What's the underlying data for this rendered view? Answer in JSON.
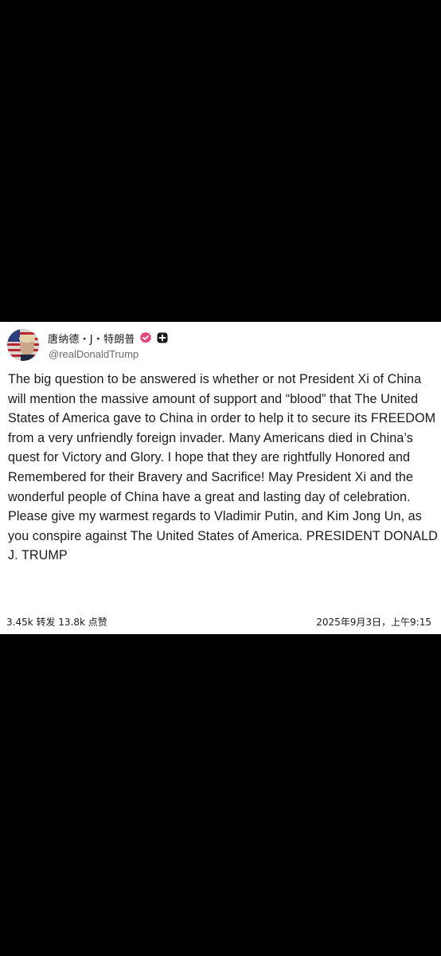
{
  "post": {
    "author": {
      "display_name": "唐纳德・J・特朗普",
      "handle": "@realDonaldTrump",
      "verified_icon": "verified-badge-icon",
      "extra_icon": "plus-badge-icon"
    },
    "body": "The big question to be  answered is whether or not President Xi of China will mention the massive amount of  support and “blood” that The United States of America gave to China in order to help it to secure its FREEDOM from a very unfriendly foreign invader. Many Americans died in China’s quest for Victory and Glory. I hope that they are rightfully Honored and Remembered for their Bravery and Sacrifice! May President Xi and the wonderful people of China have a great and lasting day of celebration. Please give my warmest regards to Vladimir Putin, and Kim Jong Un, as you conspire against The United States of America. PRESIDENT DONALD J. TRUMP",
    "stats": "3.45k 转发 13.8k 点赞",
    "timestamp": "2025年9月3日，上午9:15"
  },
  "colors": {
    "page_background": "#000000",
    "card_background": "#ffffff",
    "verified_badge": "#e0457b",
    "text": "#1a1a1a",
    "handle_text": "#6b6b6b"
  }
}
